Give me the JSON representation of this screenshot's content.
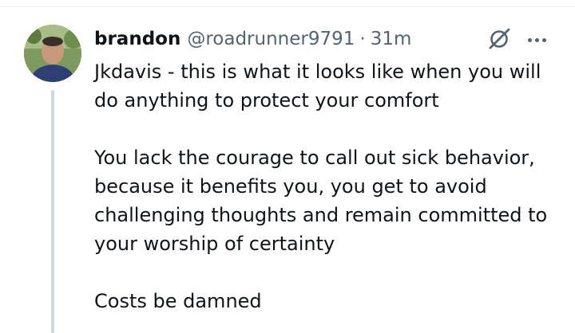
{
  "tweet": {
    "author": {
      "display_name": "brandon",
      "handle": "@roadrunner9791",
      "separator": "·",
      "time": "31m"
    },
    "icons": {
      "grok": "grok-icon",
      "more": "more-icon"
    },
    "paragraphs": [
      [
        "Jkdavis - this is what it looks like when you will",
        "do anything to protect your comfort"
      ],
      [
        "You lack the courage to call out sick behavior,",
        "because it benefits you, you get to avoid",
        "challenging thoughts and remain committed to",
        "your worship of certainty"
      ],
      [
        "Costs be damned"
      ]
    ]
  },
  "colors": {
    "primary_text": "#0f1419",
    "secondary_text": "#536471",
    "thread_line": "#cfd9de"
  }
}
